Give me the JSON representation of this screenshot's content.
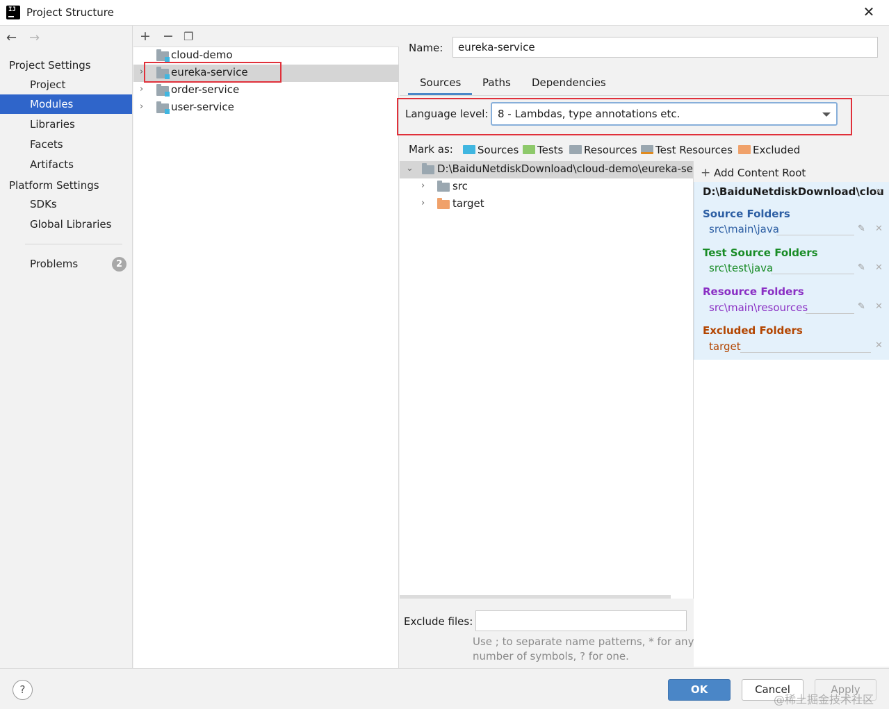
{
  "window": {
    "title": "Project Structure"
  },
  "nav": {
    "project_settings": "Project Settings",
    "items_project": [
      "Project",
      "Modules",
      "Libraries",
      "Facets",
      "Artifacts"
    ],
    "platform_settings": "Platform Settings",
    "items_platform": [
      "SDKs",
      "Global Libraries"
    ],
    "problems": "Problems",
    "problems_count": "2"
  },
  "modules": {
    "items": [
      "cloud-demo",
      "eureka-service",
      "order-service",
      "user-service"
    ]
  },
  "module": {
    "name_label": "Name:",
    "name_value": "eureka-service",
    "tabs": [
      "Sources",
      "Paths",
      "Dependencies"
    ],
    "language_level_label": "Language level:",
    "language_level_value": "8 - Lambdas, type annotations etc.",
    "mark_as_label": "Mark as:",
    "mark_as": [
      "Sources",
      "Tests",
      "Resources",
      "Test Resources",
      "Excluded"
    ],
    "tree": {
      "root": "D:\\BaiduNetdiskDownload\\cloud-demo\\eureka-ser",
      "children": [
        "src",
        "target"
      ]
    },
    "exclude_files_label": "Exclude files:",
    "exclude_files_value": "",
    "hint_line1": "Use ; to separate name patterns, * for any",
    "hint_line2": "number of symbols, ? for one."
  },
  "roots": {
    "add_label": "Add Content Root",
    "path": "D:\\BaiduNetdiskDownload\\clou",
    "groups": [
      {
        "title": "Source Folders",
        "path": "src\\main\\java",
        "color": "#2c5ea3"
      },
      {
        "title": "Test Source Folders",
        "path": "src\\test\\java",
        "color": "#198c26"
      },
      {
        "title": "Resource Folders",
        "path": "src\\main\\resources",
        "color": "#8a2fc4"
      },
      {
        "title": "Excluded Folders",
        "path": "target",
        "color": "#b34500"
      }
    ]
  },
  "buttons": {
    "ok": "OK",
    "cancel": "Cancel",
    "apply": "Apply",
    "help": "?"
  },
  "watermark": "@稀土掘金技术社区",
  "colors": {
    "selection": "#2f65ca",
    "accent": "#4a86c7",
    "highlight_box": "#e0303a"
  }
}
